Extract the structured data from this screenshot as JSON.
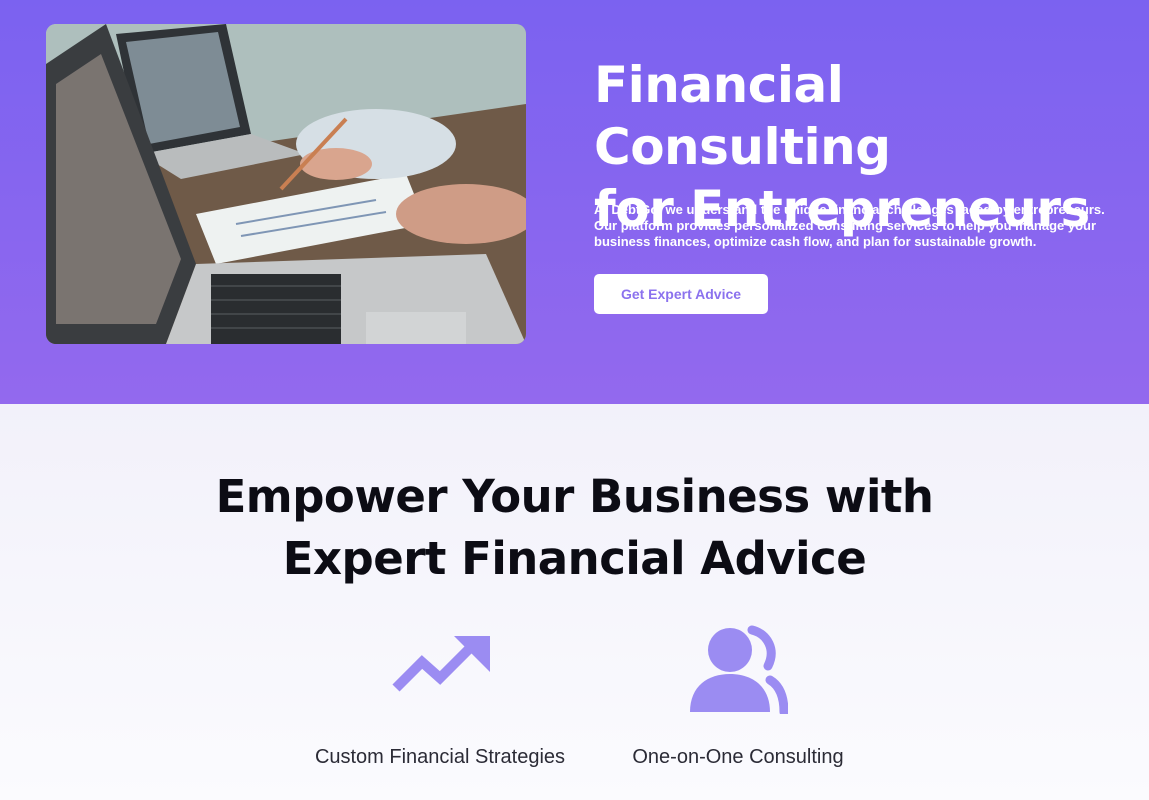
{
  "hero": {
    "image_alt": "Laptops and paperwork on a desk during a financial consultation",
    "title_line1": "Financial Consulting",
    "title_line2": "for Entrepreneurs",
    "description": "At DebtGo, we understand the unique financial challenges faced by entrepreneurs. Our platform provides personalized consulting services to help you manage your business finances, optimize cash flow, and plan for sustainable growth.",
    "button_label": "Get Expert Advice"
  },
  "features": {
    "title_line1": "Empower Your Business with",
    "title_line2": "Expert Financial Advice",
    "items": [
      {
        "icon": "trending-up-icon",
        "label": "Custom Financial Strategies"
      },
      {
        "icon": "users-icon",
        "label": "One-on-One Consulting"
      }
    ]
  },
  "colors": {
    "hero_gradient_top": "#7b62f0",
    "hero_gradient_bottom": "#9369ee",
    "accent": "#9b8cf2",
    "button_text": "#8b72ee",
    "heading_dark": "#0c0c14"
  }
}
